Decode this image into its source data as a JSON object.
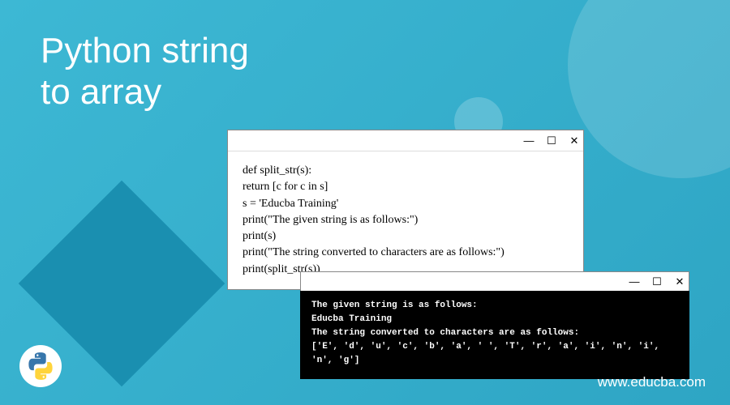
{
  "title_line1": "Python string",
  "title_line2": "to array",
  "code_window": {
    "lines": [
      "def split_str(s):",
      "return [c for c in s]",
      "s = 'Educba Training'",
      "print(\"The given string is as follows:\")",
      "print(s)",
      "print(\"The string converted to characters are as follows:\")",
      "print(split_str(s))"
    ]
  },
  "output_window": {
    "lines": [
      "The given string is as follows:",
      "Educba Training",
      "The string converted to characters are as follows:",
      "['E', 'd', 'u', 'c', 'b', 'a', ' ', 'T', 'r', 'a', 'i', 'n', 'i', 'n', 'g']"
    ]
  },
  "icons": {
    "minimize": "—",
    "maximize": "☐",
    "close": "✕"
  },
  "website": "www.educba.com"
}
